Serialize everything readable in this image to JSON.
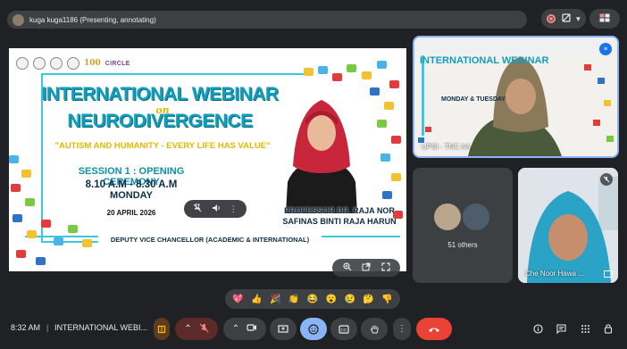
{
  "header": {
    "presenter_text": "kuga kuga1186 (Presenting, annotating)"
  },
  "slide": {
    "title_line1": "INTERNATIONAL WEBINAR",
    "title_on": "on",
    "title_line2": "NEURODIVERGENCE",
    "theme": "\"AUTISM AND HUMANITY - EVERY LIFE HAS VALUE\"",
    "session": "SESSION 1 : OPENING CEREMONY",
    "time": "8.10 A.M - 8.30 A.M",
    "day": "MONDAY",
    "date": "20 APRIL 2026",
    "speaker": "PROFESSOR DR. RAJA NOR SAFINAS BINTI RAJA HARUN",
    "role": "DEPUTY VICE CHANCELLOR (ACADEMIC & INTERNATIONAL)",
    "anniversary": "100",
    "brand": "CIRCLE"
  },
  "tiles": {
    "top_name": "UPSI - TNC AA",
    "top_slide_title": "INTERNATIONAL WEBINAR",
    "top_slide_sub": "MONDAY & TUESDAY",
    "others_count": "51 others",
    "bottom_right_name": "Che Noor Hawa ..."
  },
  "reactions": [
    "💖",
    "👍",
    "🎉",
    "👏",
    "😂",
    "😮",
    "😢",
    "🤔",
    "👎"
  ],
  "bottom": {
    "clock": "8:32 AM",
    "separator": "|",
    "meeting_title": "INTERNATIONAL WEBI..."
  },
  "colors": {
    "accent": "#8ab4f8",
    "end_call": "#ea4335",
    "slide_title": "#0f9fbd",
    "slide_yellow": "#e1b800"
  }
}
